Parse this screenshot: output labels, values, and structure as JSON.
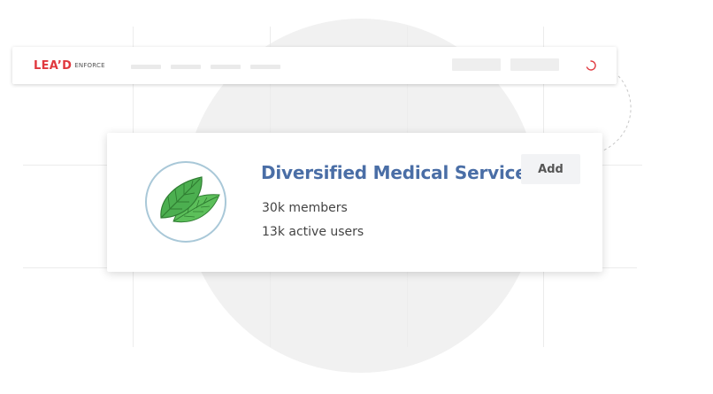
{
  "navbar": {
    "logo_main": "LEA’D",
    "logo_sub": "ENFORCE"
  },
  "card": {
    "org_name": "Diversified Medical Services",
    "members": "30k members",
    "active_users": "13k active users",
    "add_label": "Add",
    "avatar_icon": "leaf-icon"
  },
  "colors": {
    "brand_red": "#e0383e",
    "title_blue": "#4a6ea6",
    "avatar_ring": "#a9c8d8",
    "leaf_green": "#4caf50"
  }
}
